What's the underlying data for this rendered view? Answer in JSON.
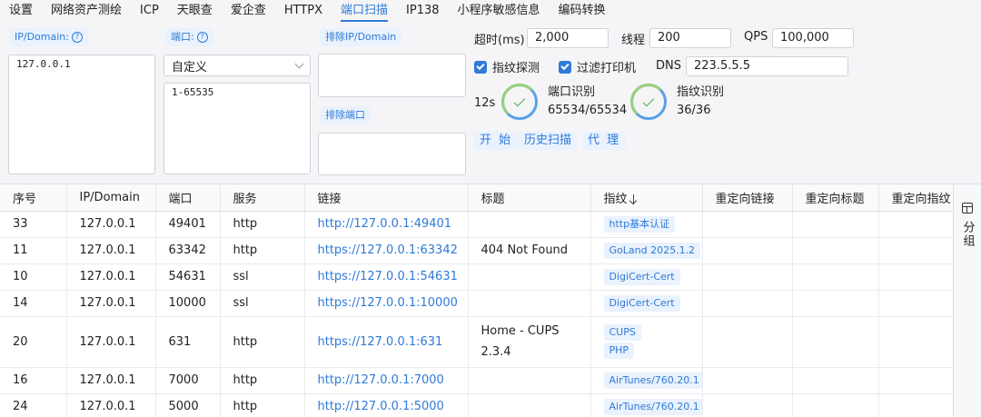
{
  "tabs": [
    {
      "label": "设置",
      "active": false
    },
    {
      "label": "网络资产测绘",
      "active": false
    },
    {
      "label": "ICP",
      "active": false
    },
    {
      "label": "天眼查",
      "active": false
    },
    {
      "label": "爱企查",
      "active": false
    },
    {
      "label": "HTTPX",
      "active": false
    },
    {
      "label": "端口扫描",
      "active": true
    },
    {
      "label": "IP138",
      "active": false
    },
    {
      "label": "小程序敏感信息",
      "active": false
    },
    {
      "label": "编码转换",
      "active": false
    }
  ],
  "form": {
    "ip_label": "IP/Domain:",
    "ip_value": "127.0.0.1",
    "port_label": "端口:",
    "port_preset": "自定义",
    "port_value": "1-65535",
    "exclude_ip_label": "排除IP/Domain",
    "exclude_port_label": "排除端口",
    "timeout_label": "超时(ms)",
    "timeout_value": "2,000",
    "threads_label": "线程",
    "threads_value": "200",
    "qps_label": "QPS",
    "qps_value": "100,000",
    "fingerprint_label": "指纹探测",
    "filter_printer_label": "过滤打印机",
    "dns_label": "DNS",
    "dns_value": "223.5.5.5"
  },
  "progress": {
    "elapsed": "12s",
    "port_title": "端口识别",
    "port_count": "65534/65534",
    "port_fraction": 1.0,
    "fp_title": "指纹识别",
    "fp_count": "36/36",
    "fp_fraction": 1.0
  },
  "actions": {
    "start": "开 始",
    "history": "历史扫描",
    "proxy": "代 理"
  },
  "table": {
    "headers": [
      "序号",
      "IP/Domain",
      "端口",
      "服务",
      "链接",
      "标题",
      "指纹",
      "重定向链接",
      "重定向标题",
      "重定向指纹"
    ],
    "rows": [
      {
        "id": "33",
        "ip": "127.0.0.1",
        "port": "49401",
        "service": "http",
        "link": "http://127.0.0.1:49401",
        "title": "",
        "fingerprints": [
          "http基本认证"
        ]
      },
      {
        "id": "11",
        "ip": "127.0.0.1",
        "port": "63342",
        "service": "http",
        "link": "https://127.0.0.1:63342",
        "title": "404 Not Found",
        "fingerprints": [
          "GoLand 2025.1.2"
        ]
      },
      {
        "id": "10",
        "ip": "127.0.0.1",
        "port": "54631",
        "service": "ssl",
        "link": "https://127.0.0.1:54631",
        "title": "",
        "fingerprints": [
          "DigiCert-Cert"
        ]
      },
      {
        "id": "14",
        "ip": "127.0.0.1",
        "port": "10000",
        "service": "ssl",
        "link": "https://127.0.0.1:10000",
        "title": "",
        "fingerprints": [
          "DigiCert-Cert"
        ]
      },
      {
        "id": "20",
        "ip": "127.0.0.1",
        "port": "631",
        "service": "http",
        "link": "https://127.0.0.1:631",
        "title": "Home - CUPS 2.3.4",
        "fingerprints": [
          "CUPS",
          "PHP"
        ]
      },
      {
        "id": "16",
        "ip": "127.0.0.1",
        "port": "7000",
        "service": "http",
        "link": "http://127.0.0.1:7000",
        "title": "",
        "fingerprints": [
          "AirTunes/760.20.1"
        ]
      },
      {
        "id": "24",
        "ip": "127.0.0.1",
        "port": "5000",
        "service": "http",
        "link": "http://127.0.0.1:5000",
        "title": "",
        "fingerprints": [
          "AirTunes/760.20.1"
        ]
      }
    ]
  },
  "side": {
    "group_label": "分组"
  },
  "colors": {
    "accent": "#2f7ad8",
    "chip_bg": "#e9f2fd",
    "success": "#4caf50"
  }
}
